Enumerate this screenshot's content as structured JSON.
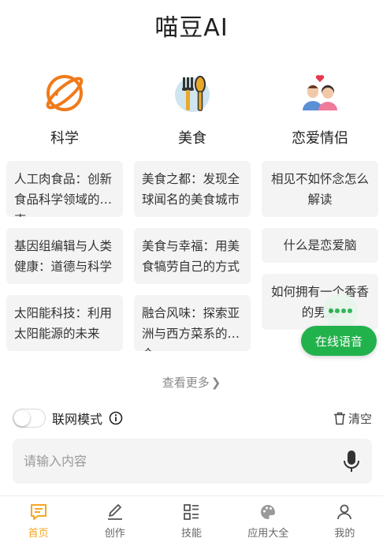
{
  "app": {
    "title": "喵豆AI"
  },
  "categories": [
    {
      "label": "科学",
      "icon": "planet-icon",
      "prompts": [
        "人工肉食品：创新食品科学领域的探索",
        "基因组编辑与人类健康：道德与科学",
        "太阳能科技：利用太阳能源的未来"
      ]
    },
    {
      "label": "美食",
      "icon": "utensils-icon",
      "prompts": [
        "美食之都：发现全球闻名的美食城市",
        "美食与幸福：用美食犒劳自己的方式",
        "融合风味：探索亚洲与西方菜系的结合"
      ]
    },
    {
      "label": "恋爱情侣",
      "icon": "couple-icon",
      "prompts": [
        "相见不如怀念怎么解读",
        "什么是恋爱脑",
        "如何拥有一个香香的男友"
      ]
    }
  ],
  "see_more": "查看更多",
  "voice": {
    "label": "在线语音"
  },
  "network_mode": {
    "label": "联网模式",
    "enabled": false
  },
  "clear": {
    "label": "清空"
  },
  "input": {
    "placeholder": "请输入内容",
    "value": ""
  },
  "tabs": [
    {
      "label": "首页",
      "icon": "home-chat-icon",
      "active": true
    },
    {
      "label": "创作",
      "icon": "pencil-icon",
      "active": false
    },
    {
      "label": "技能",
      "icon": "skills-grid-icon",
      "active": false
    },
    {
      "label": "应用大全",
      "icon": "palette-icon",
      "active": false
    },
    {
      "label": "我的",
      "icon": "user-icon",
      "active": false
    }
  ],
  "colors": {
    "accent": "#f5a623",
    "voice_green": "#22b24c",
    "science_orange": "#f07a1a"
  }
}
